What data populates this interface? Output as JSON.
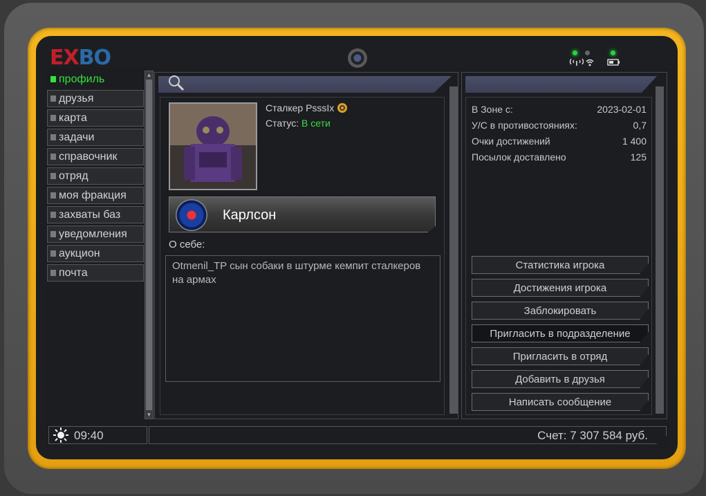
{
  "brand": {
    "logo_part1": "EX",
    "logo_part2": "BO"
  },
  "nav": {
    "items": [
      {
        "label": "профиль",
        "active": true
      },
      {
        "label": "друзья"
      },
      {
        "label": "карта"
      },
      {
        "label": "задачи"
      },
      {
        "label": "справочник"
      },
      {
        "label": "отряд"
      },
      {
        "label": "моя фракция"
      },
      {
        "label": "захваты баз"
      },
      {
        "label": "уведомления"
      },
      {
        "label": "аукцион"
      },
      {
        "label": "почта"
      }
    ]
  },
  "profile": {
    "name": "Сталкер PsssIx",
    "status_label": "Статус:",
    "status_value": "В сети",
    "clan_name": "Карлсон",
    "about_label": "О себе:",
    "about_text": "Otmenil_TP сын собаки в штурме кемпит сталкеров на армах"
  },
  "stats": [
    {
      "label": "В Зоне с:",
      "value": "2023-02-01"
    },
    {
      "label": "У/С в противостояниях:",
      "value": "0,7"
    },
    {
      "label": "Очки достижений",
      "value": "1 400"
    },
    {
      "label": "Посылок доставлено",
      "value": "125"
    }
  ],
  "actions": [
    "Статистика игрока",
    "Достижения игрока",
    "Заблокировать",
    "Пригласить в подразделение",
    "Пригласить в отряд",
    "Добавить в друзья",
    "Написать сообщение"
  ],
  "footer": {
    "time": "09:40",
    "balance": "Счет: 7 307 584 руб."
  },
  "colors": {
    "accent_green": "#35e03c",
    "device_yellow": "#f5b51e",
    "header_bar": "#4a4d66"
  },
  "icons": [
    "search-icon",
    "gear-icon",
    "sun-icon",
    "wifi-icon",
    "battery-icon",
    "camera-icon"
  ]
}
